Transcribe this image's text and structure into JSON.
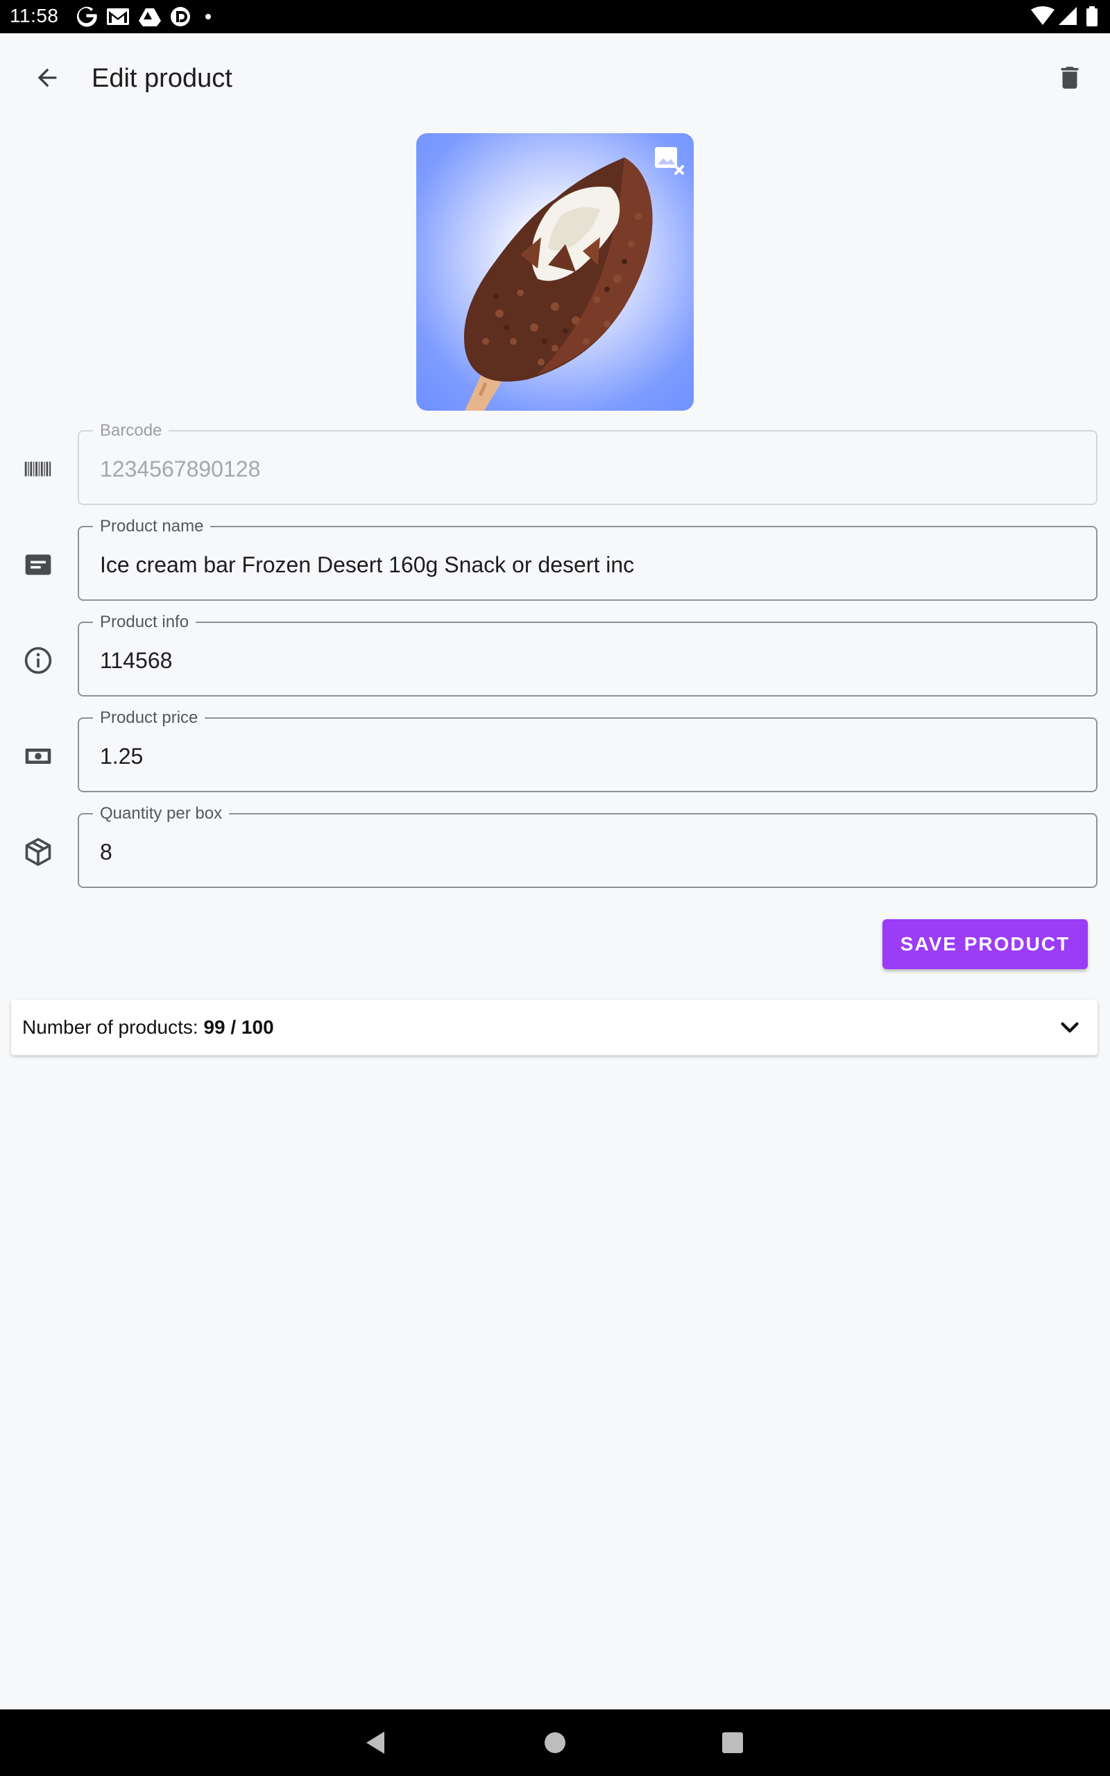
{
  "status_bar": {
    "time": "11:58",
    "notification_icons": [
      "google-icon",
      "gmail-icon",
      "drive-icon",
      "pocket-casts-icon",
      "dot-icon"
    ],
    "system_icons": [
      "wifi-icon",
      "signal-icon",
      "battery-icon"
    ]
  },
  "app_bar": {
    "title": "Edit product",
    "back_icon": "arrow-back-icon",
    "delete_icon": "trash-icon"
  },
  "product_image": {
    "description_icon": "ice-cream-bar-photo",
    "remove_icon": "image-remove-icon",
    "background_color": "#6d90ff"
  },
  "fields": [
    {
      "label": "Barcode",
      "value": "1234567890128",
      "icon": "barcode-icon",
      "disabled": true
    },
    {
      "label": "Product name",
      "value": "Ice cream bar Frozen Desert 160g Snack or desert inc",
      "icon": "label-icon"
    },
    {
      "label": "Product info",
      "value": "114568",
      "icon": "info-icon"
    },
    {
      "label": "Product price",
      "value": "1.25",
      "icon": "money-icon"
    },
    {
      "label": "Quantity per box",
      "value": "8",
      "icon": "box-icon"
    }
  ],
  "save_button": {
    "label": "SAVE PRODUCT",
    "color": "#9b3cf7"
  },
  "product_count": {
    "label": "Number of products: ",
    "value": "99 / 100",
    "expand_icon": "chevron-down-icon"
  },
  "nav_bar": {
    "icons": [
      "nav-back-icon",
      "nav-home-icon",
      "nav-recents-icon"
    ]
  }
}
